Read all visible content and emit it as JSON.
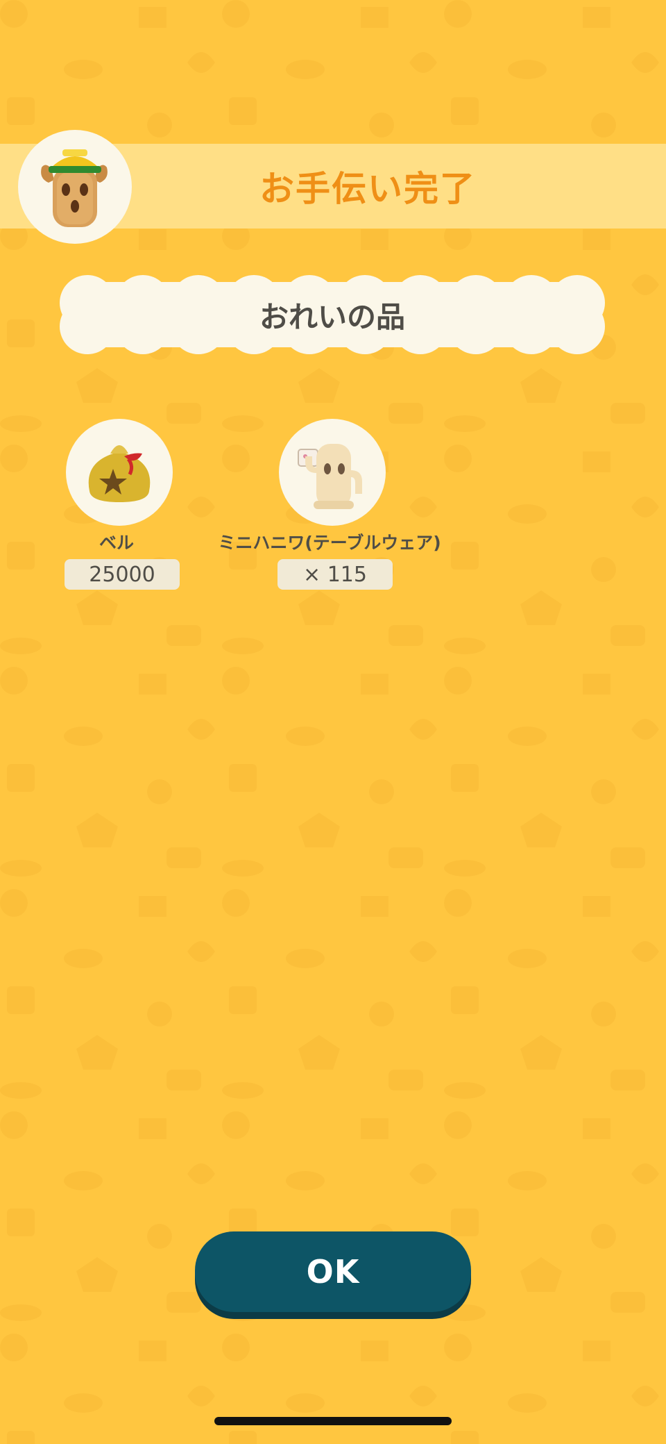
{
  "banner": {
    "title": "お手伝い完了",
    "avatar_icon": "haniwa-worker-icon"
  },
  "reward_section": {
    "title": "おれいの品"
  },
  "items": [
    {
      "name": "ベル",
      "quantity": "25000",
      "icon": "bell-bag-icon"
    },
    {
      "name": "ミニハニワ(テーブルウェア)",
      "quantity": "× 115",
      "icon": "mini-haniwa-tableware-icon"
    }
  ],
  "ok_button": {
    "label": "OK"
  },
  "colors": {
    "background": "#ffc640",
    "banner": "#ffdf86",
    "title": "#ef8f16",
    "ok_button": "#0d5566",
    "text": "#4f4d47"
  }
}
